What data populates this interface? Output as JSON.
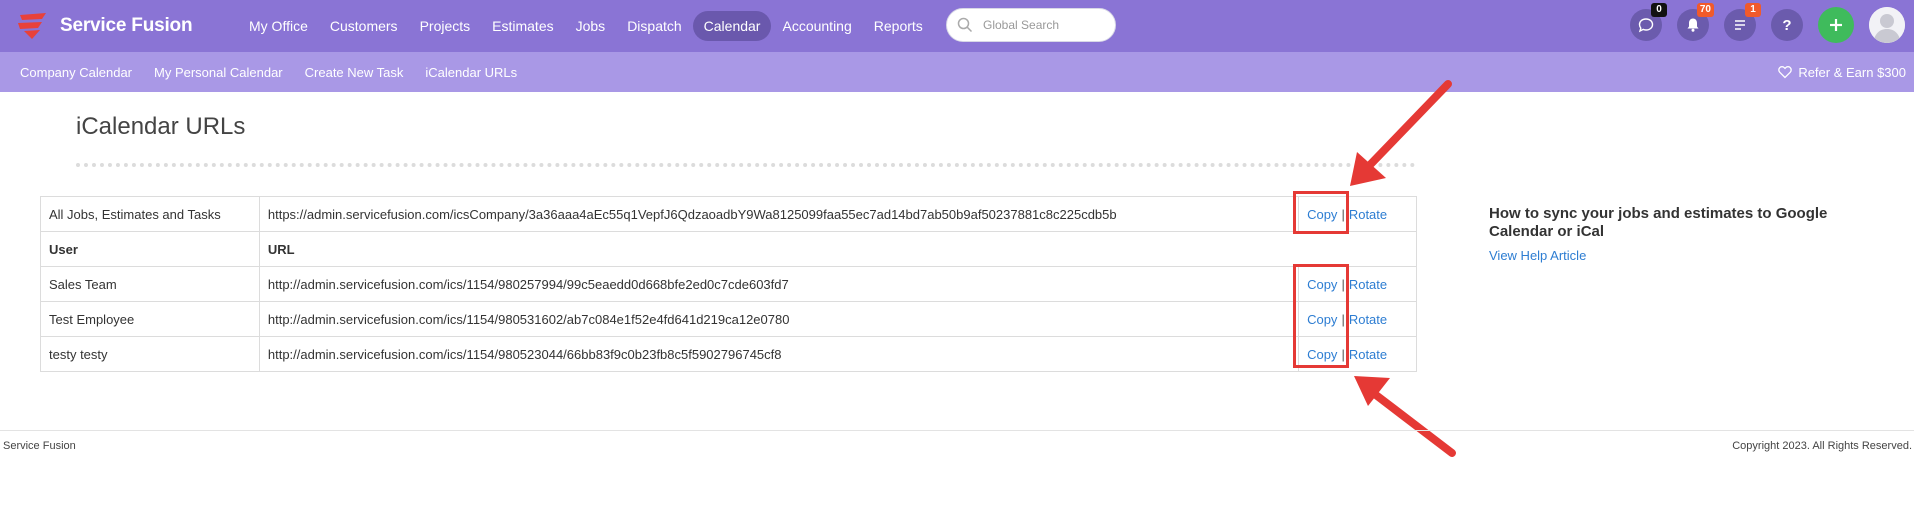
{
  "brand": {
    "name": "Service Fusion"
  },
  "main_nav": [
    "My Office",
    "Customers",
    "Projects",
    "Estimates",
    "Jobs",
    "Dispatch",
    "Calendar",
    "Accounting",
    "Reports"
  ],
  "active_nav": "Calendar",
  "search": {
    "placeholder": "Global Search"
  },
  "header_icons": {
    "chat_count": "0",
    "notifications_count": "70",
    "tasks_count": "1",
    "help_label": "?"
  },
  "sub_nav": [
    "Company Calendar",
    "My Personal Calendar",
    "Create New Task",
    "iCalendar URLs"
  ],
  "refer": {
    "label": "Refer & Earn $300"
  },
  "page": {
    "title": "iCalendar URLs"
  },
  "company_row": {
    "label": "All Jobs, Estimates and Tasks",
    "url": "https://admin.servicefusion.com/icsCompany/3a36aaa4aEc55q1VepfJ6QdzaoadbY9Wa8125099faa55ec7ad14bd7ab50b9af50237881c8c225cdb5b"
  },
  "table_headers": {
    "user": "User",
    "url": "URL"
  },
  "actions": {
    "copy": "Copy",
    "separator": "|",
    "rotate": "Rotate"
  },
  "user_rows": [
    {
      "user": "Sales Team",
      "url": "http://admin.servicefusion.com/ics/1154/980257994/99c5eaedd0d668bfe2ed0c7cde603fd7"
    },
    {
      "user": "Test Employee",
      "url": "http://admin.servicefusion.com/ics/1154/980531602/ab7c084e1f52e4fd641d219ca12e0780"
    },
    {
      "user": "testy testy",
      "url": "http://admin.servicefusion.com/ics/1154/980523044/66bb83f9c0b23fb8c5f5902796745cf8"
    }
  ],
  "help": {
    "title": "How to sync your jobs and estimates to Google Calendar or iCal",
    "link": "View Help Article"
  },
  "footer": {
    "left": "Service Fusion",
    "right": "Copyright 2023. All Rights Reserved."
  },
  "colors": {
    "topbar": "#8a74d5",
    "subbar": "#a998e6",
    "link": "#2d7dd2",
    "annotation": "#e53935",
    "add_button": "#3fbb5c"
  }
}
